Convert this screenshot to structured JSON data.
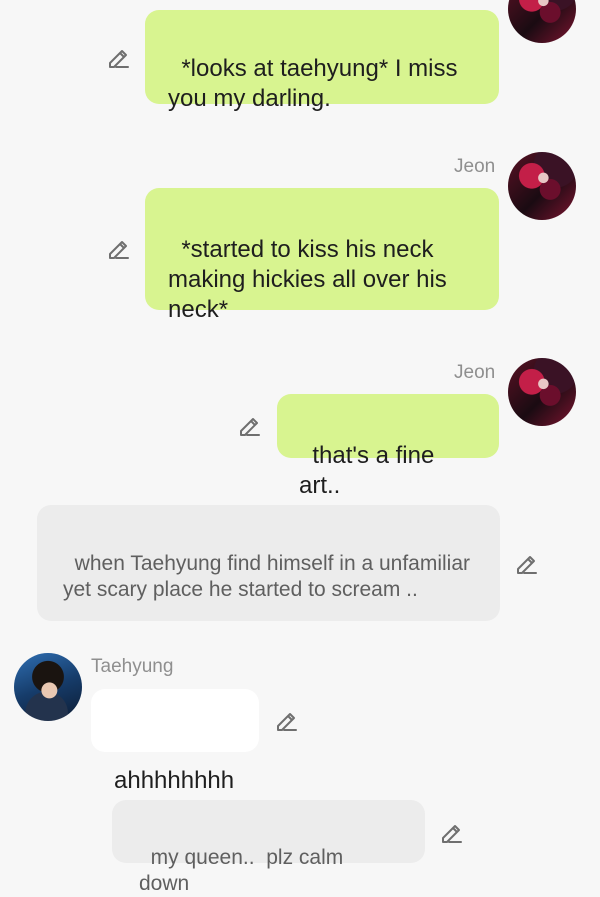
{
  "messages": [
    {
      "id": "m1",
      "sender": "",
      "text": "*looks at taehyung* I miss you my darling.",
      "style": "green"
    },
    {
      "id": "m2",
      "sender": "Jeon",
      "text": "*started to kiss his neck making hickies all over his neck*",
      "style": "green"
    },
    {
      "id": "m3",
      "sender": "Jeon",
      "text": "that's a fine art..",
      "style": "green"
    },
    {
      "id": "m4",
      "sender": "",
      "text": "when Taehyung find himself in a unfamiliar yet scary place he started to scream ..",
      "style": "grey"
    },
    {
      "id": "m5",
      "sender": "Taehyung",
      "text": "ahhhhhhhh",
      "style": "white"
    },
    {
      "id": "m6",
      "sender": "",
      "text": "my queen..  plz calm down",
      "style": "grey"
    }
  ],
  "icons": {
    "edit": "pencil-icon"
  },
  "colors": {
    "background": "#f7f7f7",
    "user_bubble": "#d8f490",
    "narration_bubble": "#ececec",
    "character_bubble": "#ffffff",
    "sender_name": "#8f8f8f"
  }
}
